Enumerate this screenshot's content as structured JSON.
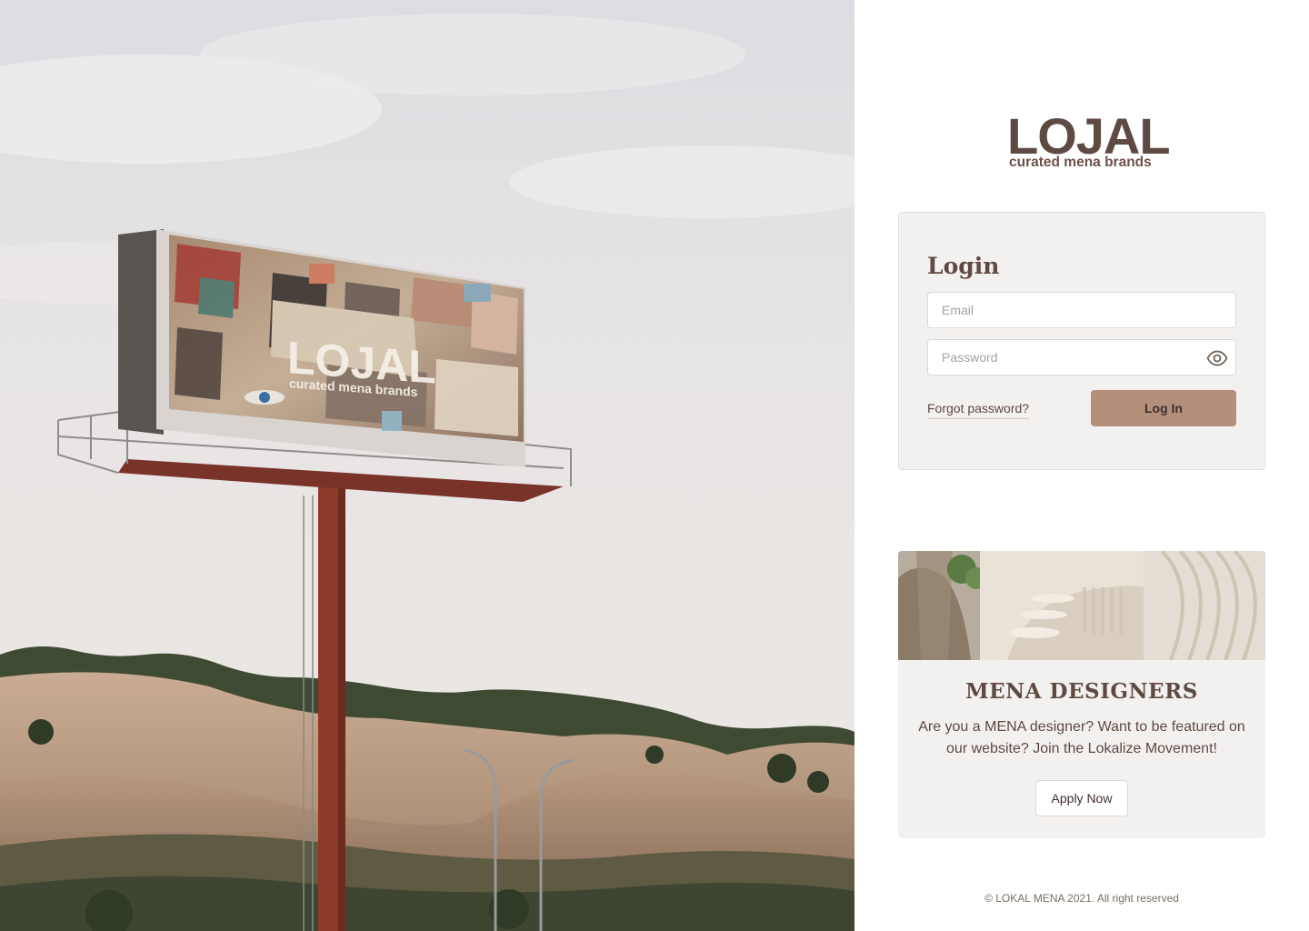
{
  "brand": {
    "wordmark": "LOJAL",
    "tagline": "curated mena brands"
  },
  "hero": {
    "billboard_wordmark": "LOJAL",
    "billboard_tagline": "curated mena brands"
  },
  "login": {
    "title": "Login",
    "email_placeholder": "Email",
    "password_placeholder": "Password",
    "forgot_label": "Forgot password?",
    "submit_label": "Log In"
  },
  "designers": {
    "title": "MENA DESIGNERS",
    "description": "Are you a MENA designer? Want to be featured on our website? Join the Lokalize Movement!",
    "apply_label": "Apply Now"
  },
  "footer": {
    "copyright": "© LOKAL MENA 2021. All right reserved"
  },
  "colors": {
    "brand_brown": "#5e4a42",
    "button_tan": "#b48f7c",
    "card_bg": "#f3f1ef"
  },
  "icons": {
    "password_toggle": "eye-icon"
  }
}
